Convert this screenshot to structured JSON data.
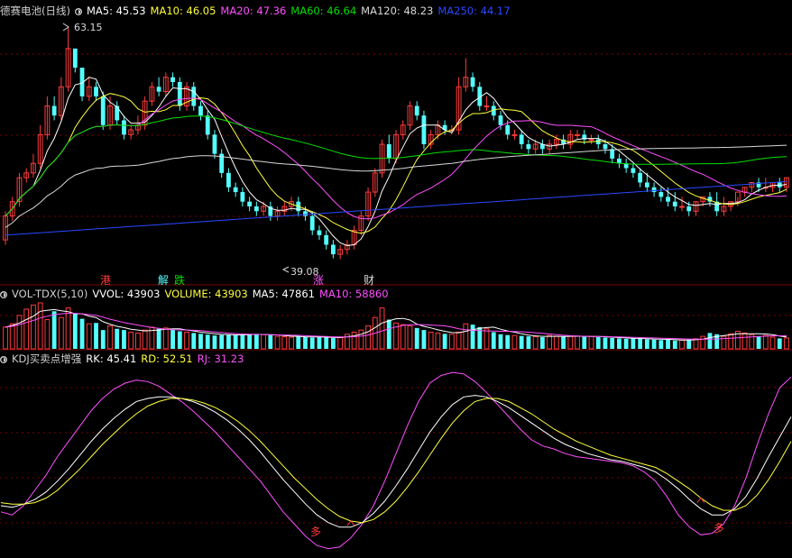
{
  "colors": {
    "up": "#ff3b3b",
    "down": "#54ffff",
    "white": "#ffffff",
    "yellow": "#ffff3c",
    "magenta": "#ff50ff",
    "green": "#00e000",
    "gray": "#d8d8d8",
    "blue": "#2a48ff",
    "grid": "#7a0000",
    "title": "#cfcfcf"
  },
  "price_header": {
    "title": "德赛电池(日线)",
    "ma5": "MA5: 45.53",
    "ma10": "MA10: 46.05",
    "ma20": "MA20: 47.36",
    "ma60": "MA60: 46.64",
    "ma120": "MA120: 48.23",
    "ma250": "MA250: 44.17"
  },
  "vol_header": {
    "title": "VOL-TDX(5,10)",
    "vvol": "VVOL: 43903",
    "volume": "VOLUME: 43903",
    "ma5": "MA5: 47861",
    "ma10": "MA10: 58860"
  },
  "kdj_header": {
    "title": "KDJ买卖点增强",
    "rk": "RK: 45.41",
    "rd": "RD: 52.51",
    "rj": "RJ: 31.23"
  },
  "annotations": {
    "high_label": "63.15",
    "low_label": "39.08",
    "signal_gang": "港",
    "signal_jie": "解",
    "signal_die": "跌",
    "signal_zhang": "涨",
    "signal_cai": "财",
    "signal_duo1": "多",
    "signal_duo2": "多"
  },
  "chart_data": {
    "type": "candlestick",
    "price": {
      "open": [
        41,
        43.5,
        45,
        47.5,
        48,
        49,
        52,
        55,
        54,
        57,
        61,
        59,
        56,
        57,
        56,
        53,
        55,
        53.5,
        52,
        52.5,
        53,
        55.5,
        57,
        56.5,
        58,
        57.5,
        55,
        57,
        55,
        54,
        52,
        50,
        48,
        46.5,
        46,
        45,
        44.5,
        44,
        44.5,
        43.5,
        44,
        44.5,
        45,
        44,
        43.5,
        42,
        41.5,
        40.5,
        39.5,
        40,
        40.5,
        42,
        43.5,
        46,
        48,
        51,
        49.5,
        52,
        53,
        55,
        54,
        51,
        52,
        53,
        52.5,
        52.5,
        57,
        58,
        57,
        55,
        55,
        54,
        53,
        52,
        52,
        51,
        50.5,
        51,
        50.5,
        51,
        51.5,
        51,
        52,
        52,
        51.5,
        51.5,
        51,
        50.5,
        49.5,
        49,
        48.5,
        48,
        47,
        46.5,
        46,
        45.5,
        45,
        44.5,
        44.5,
        44,
        45,
        45.5,
        45,
        44,
        44.5,
        45,
        46,
        46.5,
        47,
        46.5,
        46.5,
        47,
        46.5
      ],
      "close": [
        43.5,
        45,
        47.5,
        48,
        49,
        52,
        55,
        54,
        57,
        61,
        59,
        56,
        57,
        56,
        53,
        55,
        53.5,
        52,
        52.5,
        53,
        55.5,
        57,
        56.5,
        58,
        57.5,
        55,
        57,
        55,
        54,
        52,
        50,
        48,
        46.5,
        46,
        45,
        44.5,
        44,
        44.5,
        43.5,
        44,
        44.5,
        45,
        44,
        43.5,
        42,
        41.5,
        40.5,
        39.5,
        40,
        40.5,
        42,
        43.5,
        46,
        48,
        51,
        49.5,
        52,
        53,
        55,
        54,
        51,
        52,
        53,
        52.5,
        52.5,
        57,
        58,
        57,
        55,
        55,
        54,
        53,
        52,
        52,
        51,
        50.5,
        51,
        50.5,
        51,
        51.5,
        51,
        52,
        52,
        51.5,
        51.5,
        51,
        50.5,
        49.5,
        49,
        48.5,
        48,
        47,
        46.5,
        46,
        45.5,
        45,
        44.5,
        44.5,
        44,
        45,
        45.5,
        45,
        44,
        44.5,
        45,
        46,
        46.5,
        47,
        46.5,
        46.5,
        47,
        46.5,
        47.5
      ],
      "high": [
        44,
        45.5,
        48,
        48.5,
        50,
        53,
        56,
        56,
        58,
        63.15,
        61,
        59,
        58,
        57.5,
        56.5,
        56,
        55.5,
        54,
        53,
        54,
        56,
        57.5,
        58,
        58.5,
        58.5,
        58,
        57.5,
        57.5,
        55.5,
        54.5,
        52.5,
        50.5,
        48.5,
        47,
        46.5,
        45.5,
        45,
        45,
        45,
        44.5,
        45,
        45.5,
        45.5,
        44.5,
        44,
        42.5,
        42,
        41,
        40.5,
        41,
        42.5,
        44,
        46.5,
        48.5,
        51.5,
        52,
        52.5,
        53.5,
        55.5,
        55.5,
        54.5,
        52.5,
        53.5,
        53.5,
        53,
        58,
        60,
        58.5,
        57.5,
        56,
        55.5,
        54.5,
        53.5,
        52.5,
        52.5,
        51.5,
        51.5,
        51.5,
        51.5,
        52,
        52,
        52.5,
        52.5,
        52.5,
        52,
        52,
        51.5,
        51,
        50,
        49.5,
        49,
        48.5,
        48,
        47,
        46.5,
        46.5,
        46,
        45.5,
        45,
        45,
        45.5,
        46,
        46,
        45.5,
        45,
        45.5,
        46.5,
        47,
        47.5,
        47.5,
        47,
        47.5,
        47.5,
        48
      ],
      "low": [
        40.5,
        43,
        44.5,
        47,
        47.5,
        48.5,
        51.5,
        53.5,
        53.5,
        56.5,
        58.5,
        55.5,
        55.5,
        55.5,
        52.5,
        52.5,
        53,
        51.5,
        51.5,
        52,
        52.5,
        55,
        56,
        56,
        57,
        54.5,
        54.5,
        54.5,
        53.5,
        51.5,
        49.5,
        47.5,
        46,
        45.5,
        44.5,
        44,
        43.5,
        43.5,
        43,
        43,
        43.5,
        44,
        43.5,
        43,
        41.5,
        41,
        40,
        39.08,
        39,
        39.5,
        40,
        41.5,
        43,
        45.5,
        47.5,
        49,
        49,
        51.5,
        52.5,
        53.5,
        50.5,
        50.5,
        51.5,
        52,
        52,
        52,
        56.5,
        56.5,
        54.5,
        54.5,
        53.5,
        52.5,
        51.5,
        51.5,
        50.5,
        50,
        50,
        50,
        50,
        50.5,
        50.5,
        50.5,
        51.5,
        51,
        51,
        50.5,
        50,
        49,
        48.5,
        48,
        47.5,
        46.5,
        46,
        45.5,
        45,
        44.5,
        44,
        44,
        43.5,
        43.5,
        44.5,
        44.5,
        43.5,
        43.5,
        44,
        44.5,
        45.5,
        46,
        46,
        46,
        46,
        46,
        46,
        47
      ]
    },
    "volume": {
      "values": [
        52000,
        60000,
        80000,
        95000,
        105000,
        110000,
        70000,
        90000,
        75000,
        98000,
        85000,
        72000,
        60000,
        62000,
        45000,
        55000,
        48000,
        45000,
        40000,
        38000,
        45000,
        52000,
        48000,
        50000,
        46000,
        42000,
        40000,
        38000,
        36000,
        34000,
        32000,
        33000,
        34000,
        33000,
        34000,
        35000,
        36000,
        34000,
        33000,
        30000,
        29000,
        28000,
        30000,
        29000,
        27000,
        28000,
        27000,
        26000,
        28000,
        35000,
        40000,
        45000,
        55000,
        75000,
        98000,
        70000,
        62000,
        58000,
        55000,
        50000,
        45000,
        40000,
        38000,
        36000,
        35000,
        40000,
        60000,
        58000,
        52000,
        48000,
        40000,
        35000,
        33000,
        32000,
        31000,
        30000,
        29000,
        28000,
        32000,
        30000,
        29000,
        31000,
        30000,
        29000,
        30000,
        28000,
        27000,
        26000,
        25000,
        24000,
        25000,
        24000,
        23000,
        22000,
        21000,
        22000,
        20000,
        21000,
        22000,
        24000,
        30000,
        38000,
        35000,
        30000,
        36000,
        42000,
        38000,
        34000,
        30000,
        32000,
        28000,
        25000,
        26000
      ],
      "ma5": [
        52000,
        56000,
        62000,
        70000,
        78000,
        90000,
        92000,
        94000,
        91000,
        89000,
        84000,
        84000,
        78000,
        75000,
        65000,
        59000,
        54000,
        51000,
        47000,
        45000,
        43000,
        44000,
        45000,
        47000,
        48000,
        48000,
        45000,
        43000,
        40000,
        38000,
        36000,
        34500,
        34000,
        33500,
        33500,
        34000,
        34500,
        34500,
        34000,
        33500,
        32000,
        30500,
        30000,
        29000,
        28500,
        28500,
        28000,
        27500,
        27000,
        29000,
        31000,
        35000,
        41000,
        51000,
        62000,
        67000,
        72000,
        73000,
        69000,
        59000,
        54000,
        50000,
        45500,
        42000,
        39000,
        38500,
        42000,
        46000,
        49000,
        51000,
        52000,
        47000,
        43000,
        40000,
        36000,
        33000,
        31000,
        30000,
        30000,
        30000,
        29500,
        30000,
        30500,
        30000,
        29800,
        29500,
        28800,
        28000,
        27000,
        26000,
        25300,
        24800,
        24300,
        23600,
        23000,
        22600,
        22000,
        21200,
        21200,
        21800,
        23400,
        27000,
        29800,
        31800,
        33600,
        36200,
        36200,
        36000,
        36000,
        35600,
        33800,
        30800,
        28200
      ],
      "ma10": [
        52000,
        54000,
        58000,
        63000,
        68000,
        74000,
        78000,
        82000,
        84000,
        85000,
        85000,
        84000,
        82000,
        80000,
        76000,
        71000,
        67000,
        63000,
        60000,
        57000,
        54000,
        51000,
        49000,
        47000,
        46000,
        45500,
        45000,
        44500,
        43500,
        42000,
        40500,
        39000,
        37500,
        36500,
        35500,
        35000,
        34500,
        34200,
        33800,
        33500,
        33300,
        32800,
        32300,
        31500,
        30800,
        30200,
        29600,
        29000,
        28500,
        28700,
        29200,
        30500,
        33000,
        37500,
        43000,
        48000,
        52500,
        56000,
        58000,
        58000,
        58000,
        57000,
        56000,
        55000,
        52000,
        48000,
        46000,
        44500,
        43500,
        43000,
        42500,
        42000,
        42000,
        41500,
        41000,
        40000,
        38500,
        37000,
        35500,
        34000,
        32500,
        31500,
        30800,
        30300,
        30000,
        29800,
        29500,
        29000,
        28500,
        28000,
        27500,
        27000,
        26500,
        26000,
        25500,
        25000,
        24500,
        24000,
        23500,
        23000,
        23000,
        23200,
        23700,
        24500,
        25500,
        26500,
        27500,
        28500,
        29500,
        30500,
        31000,
        31200,
        31200
      ]
    },
    "kdj": {
      "rk": [
        18,
        17,
        19,
        22,
        27,
        34,
        42,
        51,
        60,
        68,
        75,
        81,
        86,
        88,
        89,
        89,
        88,
        86,
        83,
        79,
        74,
        68,
        61,
        53,
        44,
        35,
        27,
        19,
        12,
        7,
        4,
        4,
        7,
        13,
        21,
        31,
        42,
        54,
        66,
        76,
        84,
        89,
        90,
        89,
        86,
        82,
        77,
        72,
        67,
        62,
        58,
        55,
        52,
        50,
        48,
        47,
        45,
        43,
        40,
        35,
        29,
        22,
        16,
        12,
        12,
        16,
        24,
        36,
        50,
        63,
        76
      ],
      "rd": [
        20,
        19,
        19,
        20,
        23,
        28,
        35,
        42,
        50,
        58,
        65,
        72,
        78,
        83,
        86,
        88,
        88,
        87,
        85,
        82,
        78,
        73,
        67,
        60,
        52,
        44,
        36,
        29,
        22,
        16,
        11,
        8,
        7,
        9,
        14,
        21,
        30,
        40,
        51,
        62,
        72,
        80,
        86,
        88,
        88,
        86,
        82,
        78,
        73,
        68,
        64,
        60,
        57,
        54,
        51,
        49,
        47,
        45,
        43,
        39,
        34,
        29,
        23,
        18,
        15,
        15,
        18,
        25,
        35,
        47,
        60
      ],
      "rj": [
        14,
        12,
        18,
        28,
        38,
        50,
        60,
        70,
        80,
        88,
        94,
        98,
        100,
        99,
        96,
        91,
        86,
        80,
        73,
        66,
        58,
        50,
        42,
        34,
        24,
        14,
        6,
        -2,
        -8,
        -10,
        -9,
        -3,
        6,
        18,
        34,
        52,
        70,
        86,
        98,
        103,
        105,
        104,
        99,
        92,
        84,
        76,
        68,
        61,
        57,
        55,
        52,
        50,
        49,
        48,
        47,
        46,
        44,
        40,
        34,
        24,
        12,
        4,
        -1,
        0,
        6,
        18,
        36,
        58,
        78,
        95,
        102
      ],
      "duo_signals": [
        31,
        62
      ]
    }
  }
}
